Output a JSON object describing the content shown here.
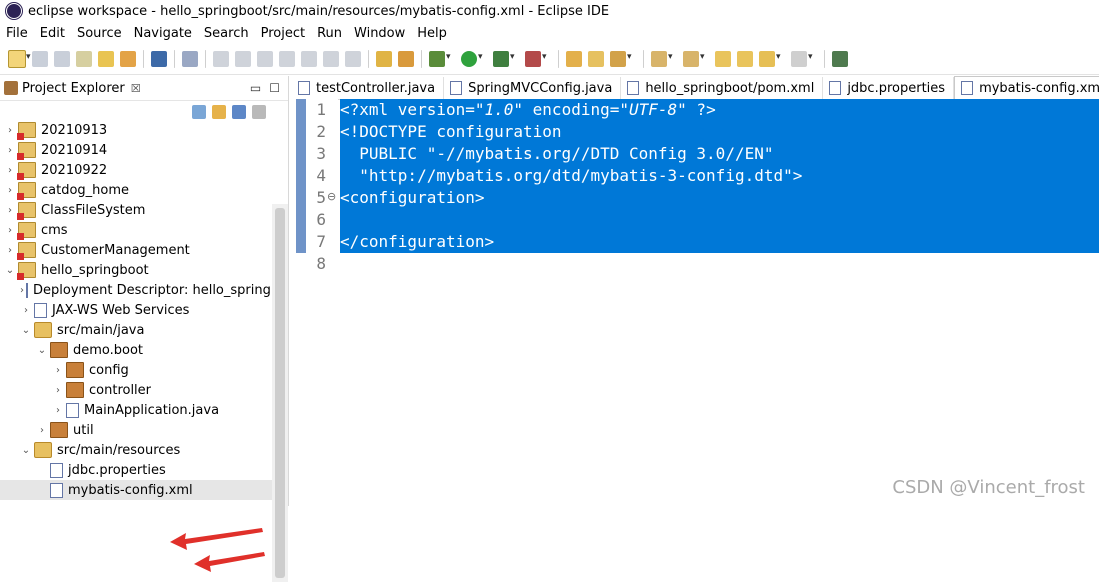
{
  "window": {
    "title": "eclipse workspace - hello_springboot/src/main/resources/mybatis-config.xml - Eclipse IDE"
  },
  "menu": [
    "File",
    "Edit",
    "Source",
    "Navigate",
    "Search",
    "Project",
    "Run",
    "Window",
    "Help"
  ],
  "project_explorer": {
    "title": "Project Explorer",
    "close_glyph": "☒",
    "minimize_glyph": "▭",
    "maximize_glyph": "☐",
    "items": [
      {
        "label": "20210913",
        "level": 0,
        "arrow": "›",
        "icon": "project"
      },
      {
        "label": "20210914",
        "level": 0,
        "arrow": "›",
        "icon": "project"
      },
      {
        "label": "20210922",
        "level": 0,
        "arrow": "›",
        "icon": "project"
      },
      {
        "label": "catdog_home",
        "level": 0,
        "arrow": "›",
        "icon": "project"
      },
      {
        "label": "ClassFileSystem",
        "level": 0,
        "arrow": "›",
        "icon": "project"
      },
      {
        "label": "cms",
        "level": 0,
        "arrow": "›",
        "icon": "project"
      },
      {
        "label": "CustomerManagement",
        "level": 0,
        "arrow": "›",
        "icon": "project"
      },
      {
        "label": "hello_springboot",
        "level": 0,
        "arrow": "⌄",
        "icon": "project"
      },
      {
        "label": "Deployment Descriptor: hello_springb",
        "level": 1,
        "arrow": "›",
        "icon": "descriptor"
      },
      {
        "label": "JAX-WS Web Services",
        "level": 1,
        "arrow": "›",
        "icon": "webservice"
      },
      {
        "label": "src/main/java",
        "level": 1,
        "arrow": "⌄",
        "icon": "srcfolder"
      },
      {
        "label": "demo.boot",
        "level": 2,
        "arrow": "⌄",
        "icon": "package"
      },
      {
        "label": "config",
        "level": 3,
        "arrow": "›",
        "icon": "package"
      },
      {
        "label": "controller",
        "level": 3,
        "arrow": "›",
        "icon": "package"
      },
      {
        "label": "MainApplication.java",
        "level": 3,
        "arrow": "›",
        "icon": "java"
      },
      {
        "label": "util",
        "level": 2,
        "arrow": "›",
        "icon": "package"
      },
      {
        "label": "src/main/resources",
        "level": 1,
        "arrow": "⌄",
        "icon": "srcfolder"
      },
      {
        "label": "jdbc.properties",
        "level": 2,
        "arrow": "",
        "icon": "file"
      },
      {
        "label": "mybatis-config.xml",
        "level": 2,
        "arrow": "",
        "icon": "xml",
        "selected": true
      }
    ]
  },
  "editor": {
    "tabs": [
      {
        "label": "testController.java"
      },
      {
        "label": "SpringMVCConfig.java"
      },
      {
        "label": "hello_springboot/pom.xml"
      },
      {
        "label": "jdbc.properties"
      },
      {
        "label": "mybatis-config.xm",
        "active": true
      }
    ],
    "line_numbers": [
      "1",
      "2",
      "3",
      "4",
      "5",
      "6",
      "7",
      "8"
    ],
    "fold_marker": "⊖",
    "lines": [
      {
        "pre": "<?xml version=",
        "q1": "\"1.0\"",
        "mid": " encoding=",
        "q2": "\"UTF-8\"",
        "post": " ?>"
      },
      {
        "text": "<!DOCTYPE configuration"
      },
      {
        "text": "  PUBLIC \"-//mybatis.org//DTD Config 3.0//EN\""
      },
      {
        "text": "  \"http://mybatis.org/dtd/mybatis-3-config.dtd\">"
      },
      {
        "text": "<configuration>"
      },
      {
        "text": ""
      },
      {
        "text": "</configuration>"
      },
      {
        "text": ""
      }
    ]
  },
  "watermark": "CSDN @Vincent_frost",
  "colors": {
    "selection": "#0078d7",
    "annotation_arrow": "#e0302a"
  }
}
